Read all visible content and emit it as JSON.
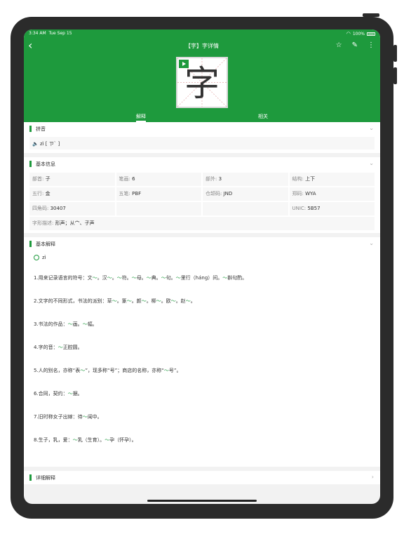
{
  "status": {
    "time": "3:34 AM",
    "date": "Tue Sep 15",
    "battery": "100%"
  },
  "nav": {
    "title": "【字】字详情"
  },
  "character": "字",
  "tabs": [
    "解释",
    "相关"
  ],
  "pinyin": {
    "heading": "拼音",
    "text": "zì [ ㄗˋ ]"
  },
  "basic_info": {
    "heading": "基本信息",
    "cells": [
      {
        "k": "部首: ",
        "v": "子"
      },
      {
        "k": "笔画: ",
        "v": "6"
      },
      {
        "k": "部外: ",
        "v": "3"
      },
      {
        "k": "结构: ",
        "v": "上下"
      },
      {
        "k": "五行: ",
        "v": "金"
      },
      {
        "k": "五笔: ",
        "v": "PBF"
      },
      {
        "k": "仓颉码: ",
        "v": "JND"
      },
      {
        "k": "郑码: ",
        "v": "WYA"
      },
      {
        "k": "四角码: ",
        "v": "30407"
      },
      {
        "k": "UNIC: ",
        "v": "5B57"
      }
    ],
    "desc_k": "字形描述: ",
    "desc_v": "形声；从宀、子声"
  },
  "basic_def": {
    "heading": "基本解释",
    "pinyin": "zì",
    "items": [
      [
        {
          "t": "1.用来记录语言的符号：文"
        },
        {
          "t": "～",
          "h": 1
        },
        {
          "t": "。汉"
        },
        {
          "t": "～",
          "h": 1
        },
        {
          "t": "。"
        },
        {
          "t": "～",
          "h": 1
        },
        {
          "t": "符。"
        },
        {
          "t": "～",
          "h": 1
        },
        {
          "t": "母。"
        },
        {
          "t": "～",
          "h": 1
        },
        {
          "t": "典。"
        },
        {
          "t": "～",
          "h": 1
        },
        {
          "t": "句。"
        },
        {
          "t": "～",
          "h": 1
        },
        {
          "t": "里行（háng）间。"
        },
        {
          "t": "～",
          "h": 1
        },
        {
          "t": "斟句酌。"
        }
      ],
      [
        {
          "t": "2.文字的不同形式，书法的派别：草"
        },
        {
          "t": "～",
          "h": 1
        },
        {
          "t": "。篆"
        },
        {
          "t": "～",
          "h": 1
        },
        {
          "t": "。颜"
        },
        {
          "t": "～",
          "h": 1
        },
        {
          "t": "。柳"
        },
        {
          "t": "～",
          "h": 1
        },
        {
          "t": "。欧"
        },
        {
          "t": "～",
          "h": 1
        },
        {
          "t": "。赵"
        },
        {
          "t": "～",
          "h": 1
        },
        {
          "t": "。"
        }
      ],
      [
        {
          "t": "3.书法的作品："
        },
        {
          "t": "～",
          "h": 1
        },
        {
          "t": "画。"
        },
        {
          "t": "～",
          "h": 1
        },
        {
          "t": "幅。"
        }
      ],
      [
        {
          "t": "4.字的音："
        },
        {
          "t": "～",
          "h": 1
        },
        {
          "t": "正腔圆。"
        }
      ],
      [
        {
          "t": "5.人的别名，亦称“表"
        },
        {
          "t": "～",
          "h": 1
        },
        {
          "t": "”，现多称“号”；商店的名称，亦称“"
        },
        {
          "t": "～",
          "h": 1
        },
        {
          "t": "号”。"
        }
      ],
      [
        {
          "t": "6.合同，契约："
        },
        {
          "t": "～",
          "h": 1
        },
        {
          "t": "据。"
        }
      ],
      [
        {
          "t": "7.旧时称女子出嫁：待"
        },
        {
          "t": "～",
          "h": 1
        },
        {
          "t": "闺中。"
        }
      ],
      [
        {
          "t": "8.生子，乳，爱："
        },
        {
          "t": "～",
          "h": 1
        },
        {
          "t": "乳（生育）。"
        },
        {
          "t": "～",
          "h": 1
        },
        {
          "t": "孕（怀孕）。"
        }
      ]
    ]
  },
  "detail": {
    "heading": "详细解释"
  },
  "colors": {
    "accent": "#1e9a3d"
  }
}
